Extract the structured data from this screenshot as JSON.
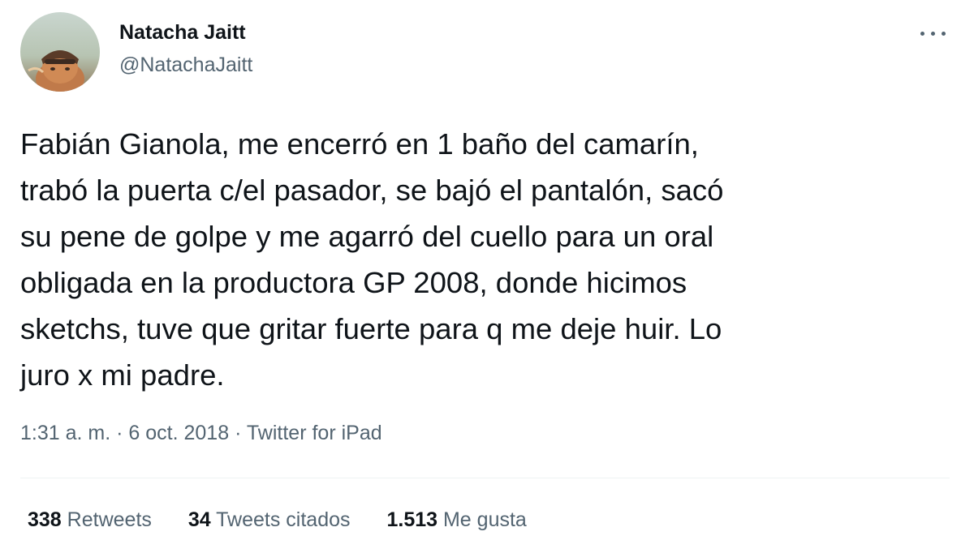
{
  "author": {
    "display_name": "Natacha Jaitt",
    "handle": "@NatachaJaitt"
  },
  "tweet": {
    "text": "Fabián Gianola, me encerró en 1 baño del camarín,\ntrabó la puerta c/el pasador, se bajó el pantalón, sacó\nsu pene de golpe y me agarró del cuello para un oral\nobligada en la productora GP 2008, donde hicimos\nsketchs, tuve que gritar fuerte para q me deje huir. Lo\njuro x mi padre."
  },
  "meta": {
    "time": "1:31 a. m.",
    "separator": "·",
    "date": "6 oct. 2018",
    "source": "Twitter for iPad"
  },
  "stats": {
    "retweets": {
      "count": "338",
      "label": "Retweets"
    },
    "quotes": {
      "count": "34",
      "label": "Tweets citados"
    },
    "likes": {
      "count": "1.513",
      "label": "Me gusta"
    }
  },
  "icons": {
    "more": "more-horizontal-icon"
  },
  "colors": {
    "text_primary": "#0f1419",
    "text_secondary": "#536471",
    "divider": "#eff3f4"
  }
}
